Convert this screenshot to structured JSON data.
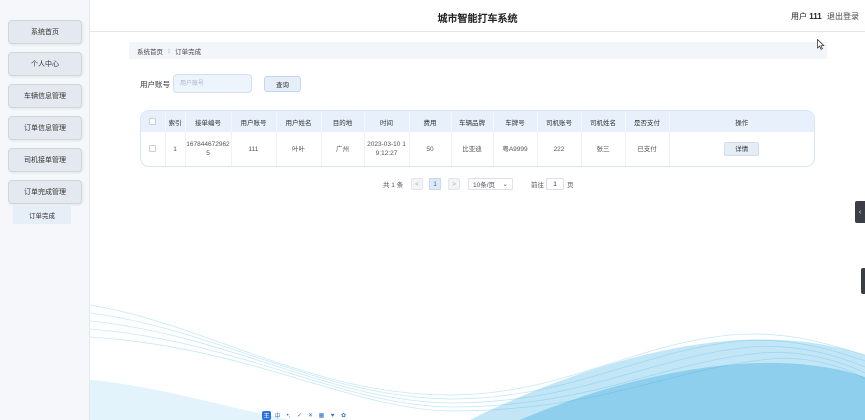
{
  "app": {
    "title": "城市智能打车系统"
  },
  "user": {
    "label": "用户",
    "name": "111",
    "logout": "退出登录"
  },
  "sidebar": {
    "items": [
      {
        "label": "系统首页"
      },
      {
        "label": "个人中心"
      },
      {
        "label": "车辆信息管理"
      },
      {
        "label": "订单信息管理"
      },
      {
        "label": "司机接单管理"
      },
      {
        "label": "订单完成管理"
      }
    ],
    "sub_item": {
      "label": "订单完成"
    }
  },
  "breadcrumb": {
    "home": "系统首页",
    "separator": "⁝",
    "current": "订单完成"
  },
  "search": {
    "label": "用户账号",
    "placeholder": "用户账号",
    "button": "查询"
  },
  "table": {
    "headers": [
      "索引",
      "接单编号",
      "用户账号",
      "用户姓名",
      "目的地",
      "时间",
      "费用",
      "车辆品牌",
      "车牌号",
      "司机账号",
      "司机姓名",
      "是否支付",
      "操作"
    ],
    "rows": [
      {
        "index": "1",
        "order_no": "1678446729625",
        "user_account": "111",
        "user_name": "叶叶",
        "destination": "广州",
        "time": "2023-03-10 19:12:27",
        "fee": "50",
        "brand": "比亚迪",
        "plate": "粤A9999",
        "driver_account": "222",
        "driver_name": "张三",
        "paid": "已支付",
        "action": "详情"
      }
    ]
  },
  "pagination": {
    "total": "共 1 条",
    "prev": "<",
    "page": "1",
    "next": ">",
    "page_size": "10条/页",
    "goto_label": "前往",
    "goto_value": "1",
    "page_unit": "页"
  },
  "edge_tab": {
    "icon": "chevron-left"
  },
  "ime": {
    "logo": "王",
    "icons": [
      "中",
      "•,",
      "✓",
      "✕",
      "▦",
      "♥",
      "✿"
    ]
  },
  "colors": {
    "accent": "#2f6fb3",
    "header_bg": "#e8f1fb",
    "wave": "#4fb6e6"
  }
}
